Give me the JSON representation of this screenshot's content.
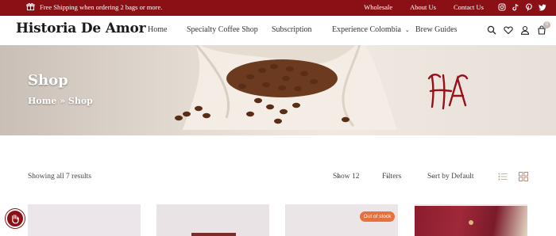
{
  "topbar": {
    "shipping_text": "Free Shipping when ordering 2 bags or more.",
    "links": [
      "Wholesale",
      "About Us",
      "Contact Us"
    ],
    "social": [
      "instagram-icon",
      "tiktok-icon",
      "pinterest-icon",
      "twitter-icon"
    ],
    "bg_color": "#8a1016"
  },
  "header": {
    "logo": "Historia De Amor",
    "nav": [
      {
        "label": "Home"
      },
      {
        "label": "Specialty Coffee Shop"
      },
      {
        "label": "Subscription"
      },
      {
        "label": "Experience Colombia",
        "has_dropdown": true
      },
      {
        "label": "Brew Guides"
      }
    ],
    "icons": [
      "search-icon",
      "heart-icon",
      "user-icon",
      "cart-icon"
    ],
    "cart_count": "0"
  },
  "banner": {
    "title": "Shop",
    "breadcrumb": "Home » Shop",
    "monogram_color": "#9a1018"
  },
  "toolbar": {
    "results": "Showing all 7 results",
    "show": "Show 12",
    "filters": "Filters",
    "sort": "Sort by Default"
  },
  "products": {
    "badge": "Out of stock",
    "accent": "#e8703c"
  }
}
